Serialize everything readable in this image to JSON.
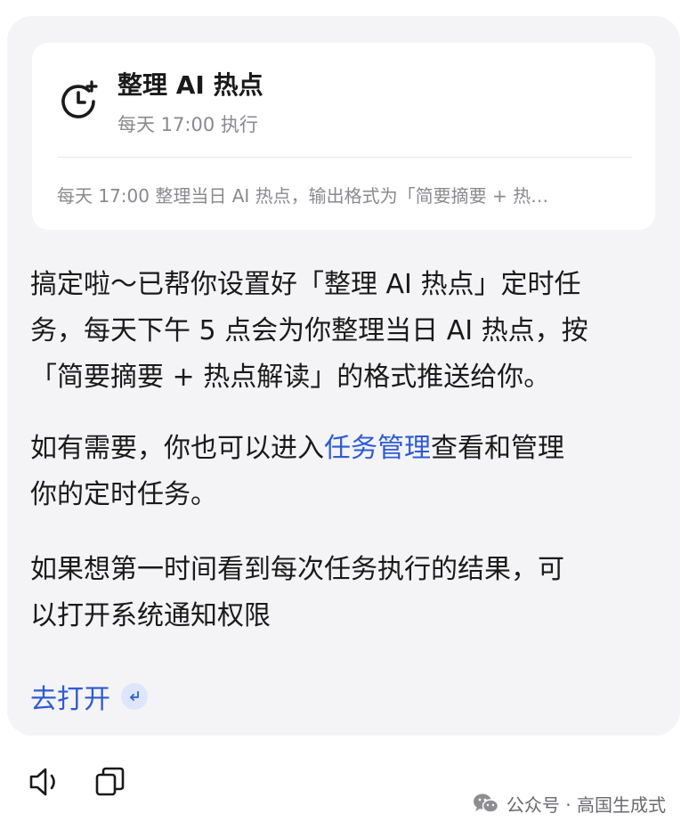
{
  "task_card": {
    "icon": "alarm-clock-plus-icon",
    "title": "整理 AI 热点",
    "schedule": "每天 17:00 执行",
    "detail": "每天 17:00 整理当日 AI 热点，输出格式为「简要摘要 + 热…"
  },
  "message": {
    "p1_line1": "搞定啦～已帮你设置好「整理 AI 热点」定时任",
    "p1_line2": "务，每天下午 5 点会为你整理当日 AI 热点，按",
    "p1_line3": "「简要摘要 + 热点解读」的格式推送给你。",
    "p2_line1_before": "如有需要，你也可以进入",
    "p2_link": "任务管理",
    "p2_line1_after": "查看和管理",
    "p2_line2": "你的定时任务。",
    "p3_line1": "如果想第一时间看到每次任务执行的结果，可",
    "p3_line2": "以打开系统通知权限"
  },
  "action": {
    "open_label": "去打开",
    "enter_icon": "return-arrow-icon"
  },
  "toolbar": {
    "speaker_icon": "speaker-icon",
    "copy_icon": "copy-icon"
  },
  "watermark": {
    "logo": "wechat-logo",
    "text": "公众号 · 高国生成式"
  },
  "colors": {
    "link": "#2d5bd8",
    "bubble_bg": "#f4f4f6",
    "secondary_text": "#8a8a8e"
  }
}
